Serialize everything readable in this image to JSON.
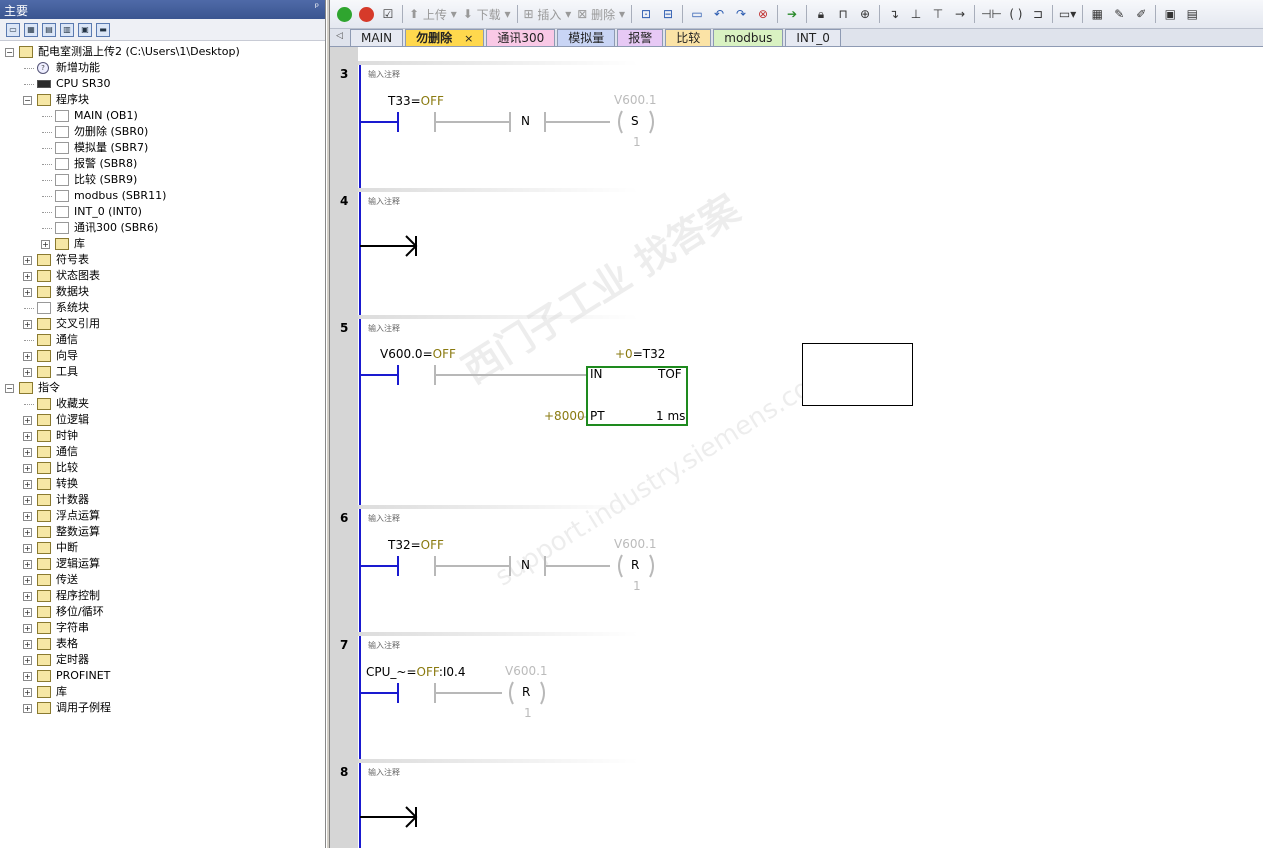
{
  "left_panel": {
    "title": "主要",
    "pin": "ᵖ",
    "tree": [
      {
        "label": "配电室测温上传2 (C:\\Users\\1\\Desktop)",
        "level": 0,
        "expander": "−",
        "icon": "project-icon"
      },
      {
        "label": "新增功能",
        "level": 1,
        "expander": "",
        "icon": "help-icon"
      },
      {
        "label": "CPU SR30",
        "level": 1,
        "expander": "",
        "icon": "cpu-icon"
      },
      {
        "label": "程序块",
        "level": 1,
        "expander": "−",
        "icon": "folder-icon"
      },
      {
        "label": "MAIN (OB1)",
        "level": 2,
        "expander": "",
        "icon": "block-icon"
      },
      {
        "label": "勿删除 (SBR0)",
        "level": 2,
        "expander": "",
        "icon": "block-icon"
      },
      {
        "label": "模拟量 (SBR7)",
        "level": 2,
        "expander": "",
        "icon": "block-icon"
      },
      {
        "label": "报警 (SBR8)",
        "level": 2,
        "expander": "",
        "icon": "block-icon"
      },
      {
        "label": "比较 (SBR9)",
        "level": 2,
        "expander": "",
        "icon": "block-icon"
      },
      {
        "label": "modbus (SBR11)",
        "level": 2,
        "expander": "",
        "icon": "block-icon"
      },
      {
        "label": "INT_0 (INT0)",
        "level": 2,
        "expander": "",
        "icon": "block-icon"
      },
      {
        "label": "通讯300 (SBR6)",
        "level": 2,
        "expander": "",
        "icon": "block-icon"
      },
      {
        "label": "库",
        "level": 2,
        "expander": "+",
        "icon": "library-icon"
      },
      {
        "label": "符号表",
        "level": 1,
        "expander": "+",
        "icon": "folder-icon"
      },
      {
        "label": "状态图表",
        "level": 1,
        "expander": "+",
        "icon": "folder-icon"
      },
      {
        "label": "数据块",
        "level": 1,
        "expander": "+",
        "icon": "folder-icon"
      },
      {
        "label": "系统块",
        "level": 1,
        "expander": "",
        "icon": "doc-icon"
      },
      {
        "label": "交叉引用",
        "level": 1,
        "expander": "+",
        "icon": "folder-icon"
      },
      {
        "label": "通信",
        "level": 1,
        "expander": "",
        "icon": "monitor-icon"
      },
      {
        "label": "向导",
        "level": 1,
        "expander": "+",
        "icon": "wizard-icon"
      },
      {
        "label": "工具",
        "level": 1,
        "expander": "+",
        "icon": "folder-icon"
      },
      {
        "label": "指令",
        "level": 0,
        "expander": "−",
        "icon": "folder-icon"
      },
      {
        "label": "收藏夹",
        "level": 1,
        "expander": "",
        "icon": "folder-icon"
      },
      {
        "label": "位逻辑",
        "level": 1,
        "expander": "+",
        "icon": "folder-icon"
      },
      {
        "label": "时钟",
        "level": 1,
        "expander": "+",
        "icon": "folder-icon"
      },
      {
        "label": "通信",
        "level": 1,
        "expander": "+",
        "icon": "folder-icon"
      },
      {
        "label": "比较",
        "level": 1,
        "expander": "+",
        "icon": "folder-icon"
      },
      {
        "label": "转换",
        "level": 1,
        "expander": "+",
        "icon": "folder-icon"
      },
      {
        "label": "计数器",
        "level": 1,
        "expander": "+",
        "icon": "folder-icon"
      },
      {
        "label": "浮点运算",
        "level": 1,
        "expander": "+",
        "icon": "folder-icon"
      },
      {
        "label": "整数运算",
        "level": 1,
        "expander": "+",
        "icon": "folder-icon"
      },
      {
        "label": "中断",
        "level": 1,
        "expander": "+",
        "icon": "folder-icon"
      },
      {
        "label": "逻辑运算",
        "level": 1,
        "expander": "+",
        "icon": "folder-icon"
      },
      {
        "label": "传送",
        "level": 1,
        "expander": "+",
        "icon": "folder-icon"
      },
      {
        "label": "程序控制",
        "level": 1,
        "expander": "+",
        "icon": "folder-icon"
      },
      {
        "label": "移位/循环",
        "level": 1,
        "expander": "+",
        "icon": "folder-icon"
      },
      {
        "label": "字符串",
        "level": 1,
        "expander": "+",
        "icon": "folder-icon"
      },
      {
        "label": "表格",
        "level": 1,
        "expander": "+",
        "icon": "folder-icon"
      },
      {
        "label": "定时器",
        "level": 1,
        "expander": "+",
        "icon": "folder-icon"
      },
      {
        "label": "PROFINET",
        "level": 1,
        "expander": "+",
        "icon": "folder-icon"
      },
      {
        "label": "库",
        "level": 1,
        "expander": "+",
        "icon": "folder-icon"
      },
      {
        "label": "调用子例程",
        "level": 1,
        "expander": "+",
        "icon": "folder-icon"
      }
    ]
  },
  "toolbar": {
    "upload_label": "上传",
    "download_label": "下载",
    "insert_label": "插入",
    "delete_label": "删除"
  },
  "tabs": [
    {
      "label": "MAIN",
      "color": "#e6e9f2",
      "active": false
    },
    {
      "label": "勿删除",
      "color": "#ffd84d",
      "active": true
    },
    {
      "label": "通讯300",
      "color": "#f9c9e6",
      "active": false
    },
    {
      "label": "模拟量",
      "color": "#c9d5f5",
      "active": false
    },
    {
      "label": "报警",
      "color": "#e7c9f5",
      "active": false
    },
    {
      "label": "比较",
      "color": "#fbe3a6",
      "active": false
    },
    {
      "label": "modbus",
      "color": "#d9f2c2",
      "active": false
    },
    {
      "label": "INT_0",
      "color": "#e6e9f2",
      "active": false
    }
  ],
  "tab_close": "×",
  "networks": [
    {
      "num": "3",
      "comment": "输入注释",
      "contact": "T33",
      "state": "OFF",
      "mid": "N",
      "coil_addr": "V600.1",
      "coil": "S",
      "coil_n": "1"
    },
    {
      "num": "4",
      "comment": "输入注释"
    },
    {
      "num": "5",
      "comment": "输入注释",
      "contact": "V600.0",
      "state": "OFF",
      "timer_preset_top": "+0",
      "timer": "T32",
      "in": "IN",
      "type": "TOF",
      "pt_value": "+8000",
      "pt": "PT",
      "base": "1 ms"
    },
    {
      "num": "6",
      "comment": "输入注释",
      "contact": "T32",
      "state": "OFF",
      "mid": "N",
      "coil_addr": "V600.1",
      "coil": "R",
      "coil_n": "1"
    },
    {
      "num": "7",
      "comment": "输入注释",
      "contact": "CPU_~",
      "state": "OFF",
      "contact_suffix": ":I0.4",
      "coil_addr": "V600.1",
      "coil": "R",
      "coil_n": "1"
    },
    {
      "num": "8",
      "comment": "输入注释"
    }
  ],
  "watermark": "西门子工业 找答案",
  "watermark_url": "support.industry.siemens.com/cs",
  "colors": {
    "rail": "#1a1ad0",
    "box": "#1e8a1e",
    "olive": "#8a7a10",
    "dim": "#b8b8b8"
  }
}
